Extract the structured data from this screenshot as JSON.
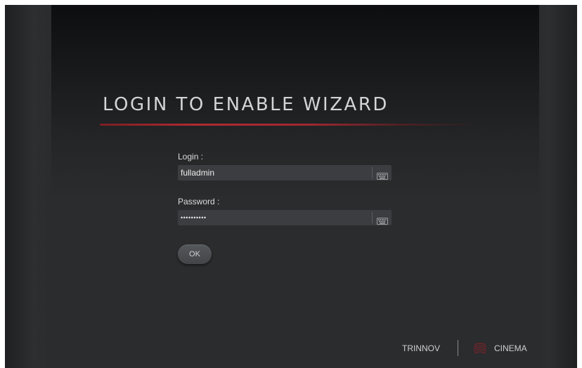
{
  "title": "LOGIN TO ENABLE WIZARD",
  "form": {
    "login": {
      "label": "Login :",
      "value": "fulladmin"
    },
    "password": {
      "label": "Password :",
      "value": "••••••••••"
    },
    "ok_label": "OK"
  },
  "footer": {
    "brand": "TRINNOV",
    "product": "CINEMA",
    "logo_icon": "trinnov-logo-icon"
  },
  "colors": {
    "accent_red": "#b02a30",
    "background": "#2a2c2e",
    "text": "#dcdcdc"
  }
}
